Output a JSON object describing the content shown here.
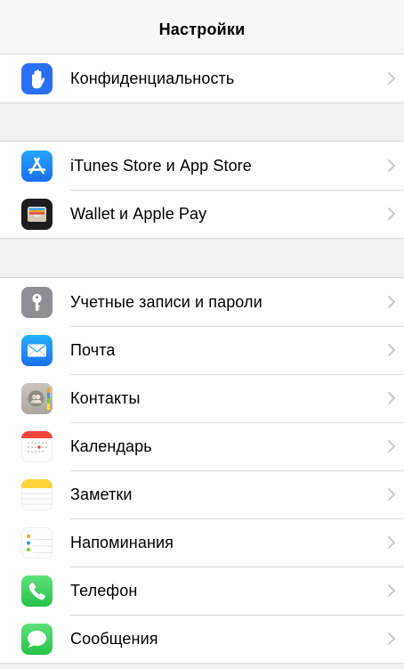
{
  "header": {
    "title": "Настройки"
  },
  "groups": [
    {
      "items": [
        {
          "label": "Конфиденциальность",
          "icon": "privacy-hand-icon",
          "color": "#2a6ff3"
        }
      ]
    },
    {
      "items": [
        {
          "label": "iTunes Store и App Store",
          "icon": "app-store-icon",
          "color": "#1e88f5"
        },
        {
          "label": "Wallet и Apple Pay",
          "icon": "wallet-icon",
          "color": "#1c1c1e"
        }
      ]
    },
    {
      "items": [
        {
          "label": "Учетные записи и пароли",
          "icon": "key-icon",
          "color": "#8e8e93"
        },
        {
          "label": "Почта",
          "icon": "mail-icon",
          "color": "#1e8ff5"
        },
        {
          "label": "Контакты",
          "icon": "contacts-icon",
          "color": "#b9b5ae"
        },
        {
          "label": "Календарь",
          "icon": "calendar-icon",
          "color": "#ffffff"
        },
        {
          "label": "Заметки",
          "icon": "notes-icon",
          "color": "#ffd33a"
        },
        {
          "label": "Напоминания",
          "icon": "reminders-icon",
          "color": "#ffffff"
        },
        {
          "label": "Телефон",
          "icon": "phone-icon",
          "color": "#34c759"
        },
        {
          "label": "Сообщения",
          "icon": "messages-icon",
          "color": "#34c759"
        }
      ]
    }
  ]
}
